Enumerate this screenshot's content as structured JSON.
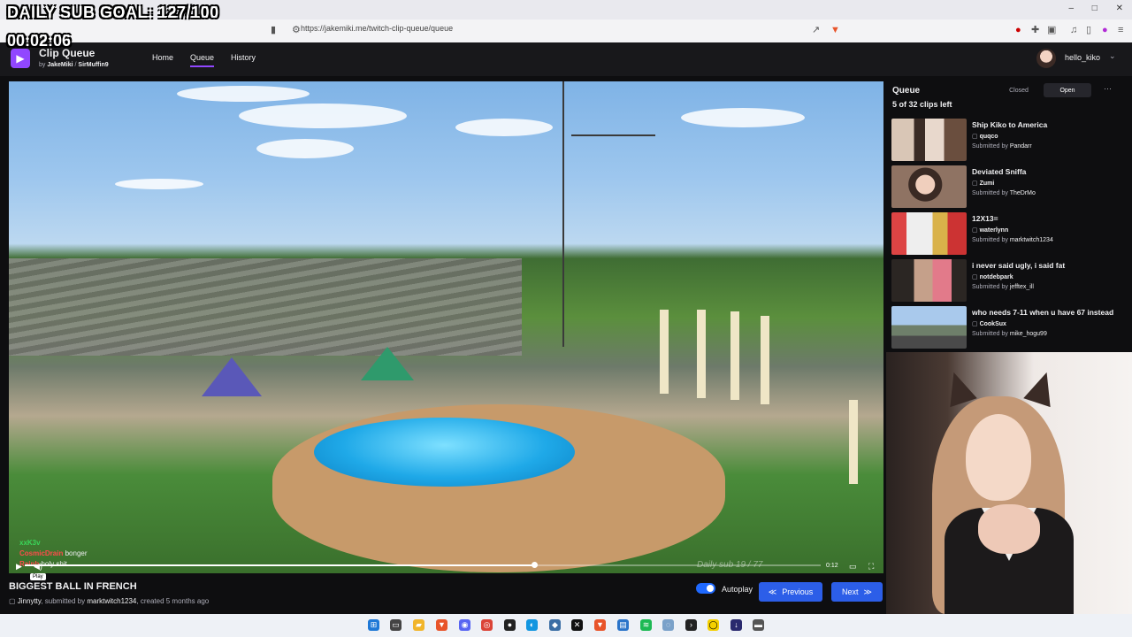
{
  "overlay": {
    "sub_goal": "DAILY SUB GOAL: 127/100",
    "timer": "00:02:06"
  },
  "browser": {
    "url": "https://jakemiki.me/twitch-clip-queue/queue"
  },
  "app": {
    "title": "Clip Queue",
    "by": "by",
    "author1": "JakeMiki",
    "separator": "/",
    "author2": "SirMuffin9",
    "nav": [
      "Home",
      "Queue",
      "History"
    ],
    "user": "hello_kiko"
  },
  "player": {
    "chat": [
      {
        "user": "xxK3v",
        "color": "#3ad65a"
      },
      {
        "user": "CosmicDrain",
        "msg": "bonger",
        "color": "#ff4b4b"
      },
      {
        "user": "Rainb",
        "msg": "holy shit",
        "color": "#ff4b4b"
      }
    ],
    "tooltip": "Play",
    "watermark": "Daily sub 19 / 77",
    "duration": "0:12",
    "progress_fraction": 0.64
  },
  "clip": {
    "title": "BIGGEST BALL IN FRENCH",
    "channel": "Jinnytty",
    "submitted_prefix": ", submitted by",
    "submitter": "marktwitch1234",
    "created": ", created 5 months ago"
  },
  "controls": {
    "autoplay": "Autoplay",
    "previous": "Previous",
    "next": "Next"
  },
  "queue": {
    "title": "Queue",
    "closed": "Closed",
    "open": "Open",
    "count": "5 of 32 clips left",
    "items": [
      {
        "title": "Ship Kiko to America",
        "channel": "quqco",
        "submitted_prefix": "Submitted by",
        "submitter": "Pandarr"
      },
      {
        "title": "Deviated Sniffa",
        "channel": "Zumi",
        "submitted_prefix": "Submitted by",
        "submitter": "TheDrMo"
      },
      {
        "title": "12X13=",
        "channel": "waterlynn",
        "submitted_prefix": "Submitted by",
        "submitter": "marktwitch1234"
      },
      {
        "title": "i never said ugly, i said fat",
        "channel": "notdebpark",
        "submitted_prefix": "Submitted by",
        "submitter": "jefftex_ill"
      },
      {
        "title": "who needs 7-11 when u have 67 instead",
        "channel": "CookSux",
        "submitted_prefix": "Submitted by",
        "submitter": "mike_hogu99"
      }
    ]
  },
  "colors": {
    "accent": "#9147ff",
    "button": "#2c5ee8",
    "toggle": "#1f69ff",
    "panel": "#18181b"
  }
}
